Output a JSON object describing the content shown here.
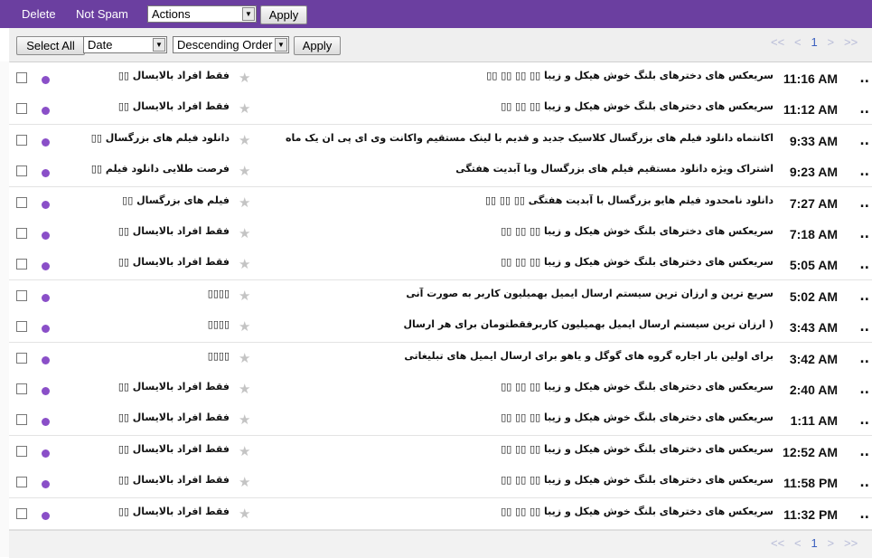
{
  "topbar": {
    "delete": "Delete",
    "not_spam": "Not Spam",
    "actions_select": "Actions",
    "apply": "Apply"
  },
  "toolbar": {
    "select_all": "Select All",
    "sort_field": "Date",
    "sort_order": "Descending Order",
    "apply": "Apply"
  },
  "pagination": {
    "first": "<<",
    "prev": "<",
    "page": "1",
    "next": ">",
    "last": ">>"
  },
  "messages": [
    {
      "sender": "فقط افراد بالایسال ▯▯",
      "subject": "سریعکس های دخترهای بلنگ خوش هیکل و زیبا ▯▯ ▯▯ ▯▯ ▯▯",
      "time": "11:16 AM"
    },
    {
      "sender": "فقط افراد بالایسال ▯▯",
      "subject": "سریعکس های دخترهای بلنگ خوش هیکل و زیبا ▯▯ ▯▯ ▯▯",
      "time": "11:12 AM"
    },
    {
      "sender": "دانلود فیلم های بزرگسال ▯▯",
      "subject": "اکانتماه دانلود فیلم های بزرگسال کلاسیک جدید و قدیم با لینک مستقیم واکانت وی ای پی ان یک ماه",
      "time": "9:33 AM"
    },
    {
      "sender": "فرصت طلایی دانلود فیلم ▯▯",
      "subject": "اشتراک ویژه دانلود مستقیم فیلم های بزرگسال وبا آبدیت هفتگی",
      "time": "9:23 AM"
    },
    {
      "sender": "فیلم های بزرگسال ▯▯",
      "subject": "دانلود نامحدود فیلم هایو بزرگسال با آبدیت هفتگی ▯▯ ▯▯ ▯▯",
      "time": "7:27 AM"
    },
    {
      "sender": "فقط افراد بالایسال ▯▯",
      "subject": "سریعکس های دخترهای بلنگ خوش هیکل و زیبا ▯▯ ▯▯ ▯▯",
      "time": "7:18 AM"
    },
    {
      "sender": "فقط افراد بالایسال ▯▯",
      "subject": "سریعکس های دخترهای بلنگ خوش هیکل و زیبا ▯▯ ▯▯ ▯▯",
      "time": "5:05 AM"
    },
    {
      "sender": "▯▯▯▯",
      "subject": "سریع ترین و ارزان ترین سیستم ارسال ایمیل بهمیلیون کاربر به صورت آنی",
      "time": "5:02 AM"
    },
    {
      "sender": "▯▯▯▯",
      "subject": "( ارزان ترین سیستم ارسال ایمیل بهمیلیون کاربرفقطتومان برای هر ارسال",
      "time": "3:43 AM"
    },
    {
      "sender": "▯▯▯▯",
      "subject": "برای اولین بار اجاره گروه های گوگل و یاهو برای ارسال ایمیل های تبلیغاتی",
      "time": "3:42 AM"
    },
    {
      "sender": "فقط افراد بالایسال ▯▯",
      "subject": "سریعکس های دخترهای بلنگ خوش هیکل و زیبا ▯▯ ▯▯ ▯▯",
      "time": "2:40 AM"
    },
    {
      "sender": "فقط افراد بالایسال ▯▯",
      "subject": "سریعکس های دخترهای بلنگ خوش هیکل و زیبا ▯▯ ▯▯ ▯▯",
      "time": "1:11 AM"
    },
    {
      "sender": "فقط افراد بالایسال ▯▯",
      "subject": "سریعکس های دخترهای بلنگ خوش هیکل و زیبا ▯▯ ▯▯ ▯▯",
      "time": "12:52 AM"
    },
    {
      "sender": "فقط افراد بالایسال ▯▯",
      "subject": "سریعکس های دخترهای بلنگ خوش هیکل و زیبا ▯▯ ▯▯ ▯▯",
      "time": "11:58 PM"
    },
    {
      "sender": "فقط افراد بالایسال ▯▯",
      "subject": "سریعکس های دخترهای بلنگ خوش هیکل و زیبا ▯▯ ▯▯ ▯▯",
      "time": "11:32 PM"
    }
  ],
  "row_more": "..",
  "colors": {
    "topbar": "#6b3fa0",
    "unread_dot": "#8a4fc8",
    "page_current": "#3a5fbf"
  },
  "icons": {
    "star": "star-icon",
    "unread": "unread-dot-icon",
    "dropdown": "chevron-down-icon"
  }
}
